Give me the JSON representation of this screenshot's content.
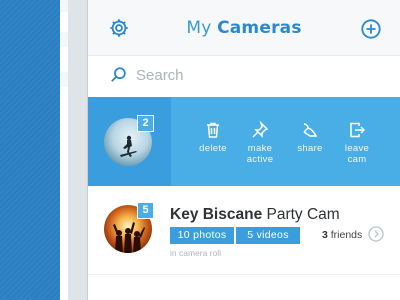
{
  "header": {
    "title_light": "My",
    "title_bold": "Cameras",
    "settings_icon": "gear-icon",
    "add_icon": "plus-circle-icon"
  },
  "search": {
    "placeholder": "Search",
    "value": "",
    "icon": "search-icon"
  },
  "swiped_row": {
    "badge_count": "2",
    "actions": [
      {
        "icon": "trash-icon",
        "label": "delete"
      },
      {
        "icon": "pin-icon",
        "label": "make\nactive"
      },
      {
        "icon": "share-icon",
        "label": "share"
      },
      {
        "icon": "leave-icon",
        "label": "leave\ncam"
      }
    ]
  },
  "cameras": [
    {
      "name_bold": "Key Biscane",
      "name_rest": " Party Cam",
      "badge_count": "5",
      "photos": "10 photos",
      "videos": "5 videos",
      "friends_count": "3",
      "friends_label": " friends",
      "subtitle": "in camera roll"
    }
  ],
  "colors": {
    "accent": "#4aaee6",
    "accent_dark": "#3a9ede",
    "side_blue": "#2a7fc2"
  }
}
